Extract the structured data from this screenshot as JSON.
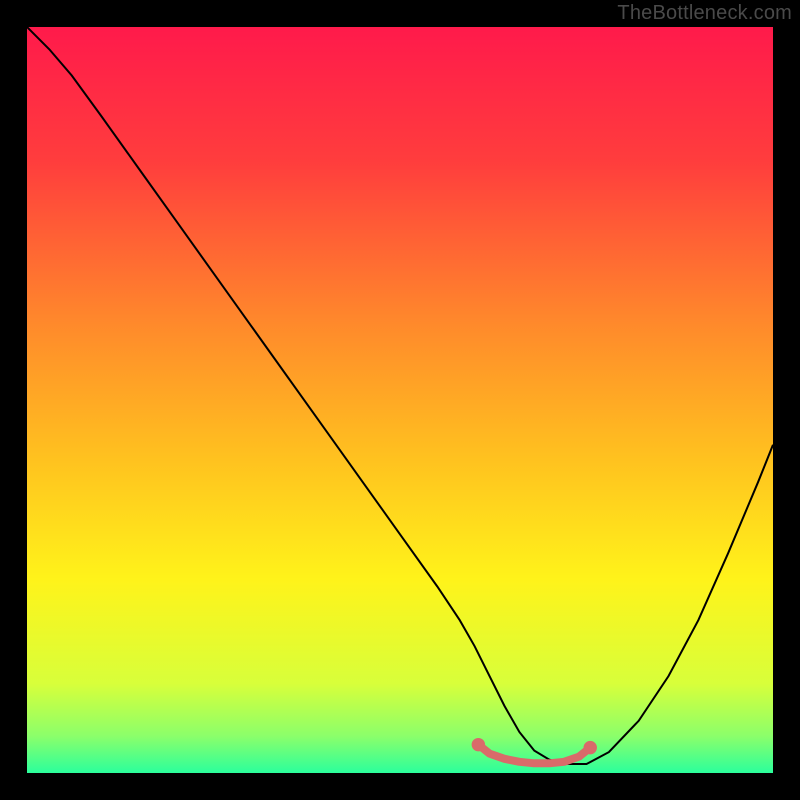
{
  "watermark": "TheBottleneck.com",
  "chart_data": {
    "type": "line",
    "title": "",
    "xlabel": "",
    "ylabel": "",
    "xlim": [
      0,
      100
    ],
    "ylim": [
      0,
      100
    ],
    "background_gradient": {
      "stops": [
        {
          "offset": 0.0,
          "color": "#ff1a4b"
        },
        {
          "offset": 0.18,
          "color": "#ff3d3d"
        },
        {
          "offset": 0.4,
          "color": "#ff8a2b"
        },
        {
          "offset": 0.58,
          "color": "#ffc21f"
        },
        {
          "offset": 0.74,
          "color": "#fff31a"
        },
        {
          "offset": 0.88,
          "color": "#d8ff3a"
        },
        {
          "offset": 0.95,
          "color": "#8cff6a"
        },
        {
          "offset": 1.0,
          "color": "#2bff9c"
        }
      ]
    },
    "series": [
      {
        "name": "curve",
        "color": "#000000",
        "width": 2,
        "x": [
          0,
          3,
          6,
          10,
          15,
          20,
          25,
          30,
          35,
          40,
          45,
          50,
          55,
          58,
          60,
          62,
          64,
          66,
          68,
          70,
          72,
          75,
          78,
          82,
          86,
          90,
          94,
          98,
          100
        ],
        "y": [
          100,
          97,
          93.5,
          88,
          81,
          74,
          67,
          60,
          53,
          46,
          39,
          32,
          25,
          20.5,
          17,
          13,
          9,
          5.5,
          3,
          1.8,
          1.2,
          1.2,
          2.8,
          7,
          13,
          20.5,
          29.5,
          39,
          44
        ]
      }
    ],
    "highlight": {
      "color": "#d96a6a",
      "radius": 5,
      "line_width": 8,
      "x": [
        60.5,
        62,
        64,
        66,
        68,
        70,
        72,
        74,
        75.5
      ],
      "y": [
        3.8,
        2.6,
        1.9,
        1.5,
        1.3,
        1.3,
        1.5,
        2.2,
        3.4
      ]
    }
  }
}
